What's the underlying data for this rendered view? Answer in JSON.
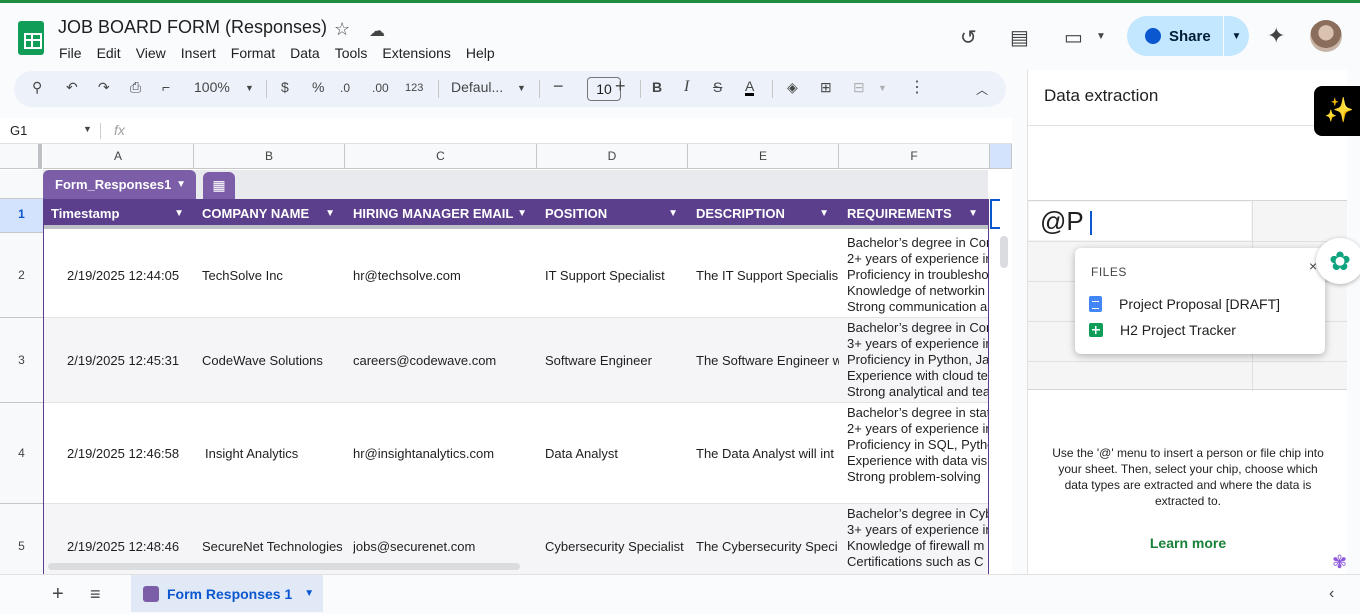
{
  "doc": {
    "title": "JOB BOARD FORM (Responses)",
    "menu": [
      "File",
      "Edit",
      "View",
      "Insert",
      "Format",
      "Data",
      "Tools",
      "Extensions",
      "Help"
    ],
    "share_label": "Share"
  },
  "toolbar": {
    "zoom": "100%",
    "currency": "$",
    "percent": "%",
    "dec_less": ".0",
    "dec_more": ".00",
    "number_format": "123",
    "font": "Defaul...",
    "font_size": "10",
    "bold": "B",
    "italic": "I"
  },
  "formula": {
    "cell_ref": "G1",
    "fx": "fx"
  },
  "columns": [
    "A",
    "B",
    "C",
    "D",
    "E",
    "F"
  ],
  "table": {
    "name": "Form_Responses1",
    "headers": [
      "Timestamp",
      "COMPANY NAME",
      "HIRING MANAGER EMAIL",
      "POSITION",
      "DESCRIPTION",
      "REQUIREMENTS"
    ],
    "rows": [
      {
        "num": "2",
        "timestamp": "2/19/2025 12:44:05",
        "company": "TechSolve Inc",
        "email": "hr@techsolve.com",
        "position": "IT Support Specialist",
        "description": "The IT Support Specialis",
        "requirements": [
          "Bachelor’s degree in Com",
          "2+ years of experience in",
          "Proficiency in troublesho",
          "Knowledge of networkin",
          "Strong communication a"
        ]
      },
      {
        "num": "3",
        "timestamp": "2/19/2025 12:45:31",
        "company": "CodeWave Solutions",
        "email": "careers@codewave.com",
        "position": "Software Engineer",
        "description": "The Software Engineer w",
        "requirements": [
          "Bachelor’s degree in Com",
          "3+ years of experience in",
          "Proficiency in Python, Ja",
          "Experience with cloud te",
          "Strong analytical and tea"
        ]
      },
      {
        "num": "4",
        "timestamp": "2/19/2025 12:46:58",
        "company": "Insight Analytics",
        "email": "hr@insightanalytics.com",
        "position": "Data Analyst",
        "description": "The Data Analyst will int",
        "requirements": [
          "Bachelor’s degree in stat",
          "2+ years of experience in",
          "Proficiency in SQL, Pytho",
          "Experience with data vis",
          "Strong problem-solving"
        ]
      },
      {
        "num": "5",
        "timestamp": "2/19/2025 12:48:46",
        "company": "SecureNet Technologies",
        "email": "jobs@securenet.com",
        "position": "Cybersecurity Specialist",
        "description": "The Cybersecurity Speci",
        "requirements": [
          "Bachelor’s degree in Cyb",
          "3+ years of experience in",
          "Knowledge of firewall m",
          "Certifications such as C"
        ]
      }
    ]
  },
  "row_header_one": "1",
  "sheet_tab": "Form Responses 1",
  "panel": {
    "title": "Data extraction",
    "input_value": "@P",
    "popup_label": "FILES",
    "files": [
      "Project Proposal [DRAFT]",
      "H2 Project Tracker"
    ],
    "help": "Use the '@' menu to insert a person or file chip into your sheet. Then, select your chip, choose which data types are extracted and where the data is extracted to.",
    "learn_more": "Learn more"
  },
  "colors": {
    "table_header": "#5b3f8c",
    "table_tab": "#7b5ea7",
    "share_bg": "#c2e7ff",
    "learn_more": "#188038"
  }
}
